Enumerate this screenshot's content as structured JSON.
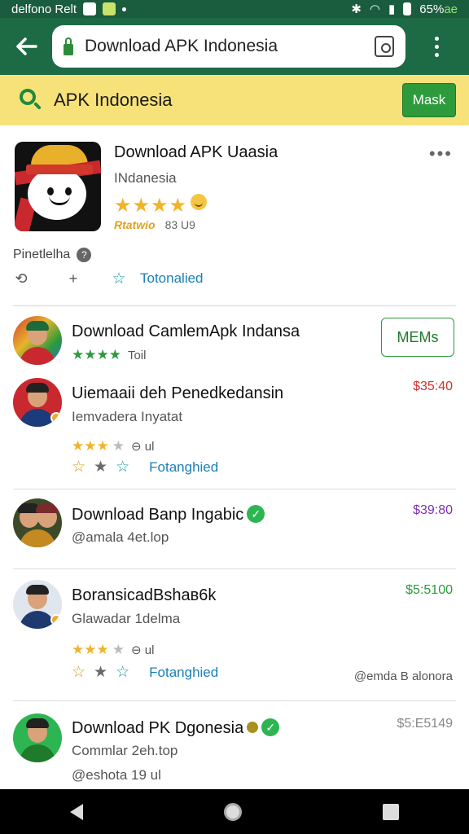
{
  "status_bar": {
    "left_text": "delfono Relt",
    "battery_text": "65%",
    "battery_accent": "ae"
  },
  "browser": {
    "url": "Download APK Indonesia"
  },
  "search_bar": {
    "title": "APK Indonesia",
    "button_label": "Mask"
  },
  "featured": {
    "title": "Download APK Uaasia",
    "subtitle": "INdanesia",
    "stars": "★★★★",
    "rates_text": "Rtatwio",
    "count_text": "83 U9",
    "more": "•••",
    "label": "Pinetlelha",
    "action_link": "Totonalied"
  },
  "rows": [
    {
      "title": "Download CamlemApk Indansa",
      "stars": "★★★★",
      "sub": "Toil",
      "button": "MEMs"
    },
    {
      "title": "Uiemaaii deh Penedkedansin",
      "sub": "Iemvadera Inyatat",
      "price": "$35:40",
      "price_color": "#d0312d",
      "rating": "★★★",
      "rating_empty": "★",
      "count": "⊖ ul",
      "action_link": "Fotanghied"
    },
    {
      "title": "Download Banp Ingabic",
      "sub": "@amala 4et.lop",
      "price": "$39:80",
      "price_color": "#7b2fb5"
    },
    {
      "title": "BoransicadBshaʙ6k",
      "sub": "Glawadar 1delma",
      "price": "$5:5100",
      "price_color": "#2a9a3c",
      "rating": "★★★",
      "rating_empty": "★",
      "count": "⊖ ul",
      "action_link": "Fotanghied",
      "footnote": "@emda B alonora"
    },
    {
      "title": "Download PK Dgonesia",
      "sub": "Commlar 2eh.top",
      "sub2": "@eshota 19 ul",
      "price": "$5:E5149",
      "price_color": "#888888"
    }
  ],
  "colors": {
    "app_bar": "#1d6b45",
    "search_bar": "#f7e27a",
    "accent_green": "#2d9a3c",
    "link_blue": "#1a7fb5"
  }
}
